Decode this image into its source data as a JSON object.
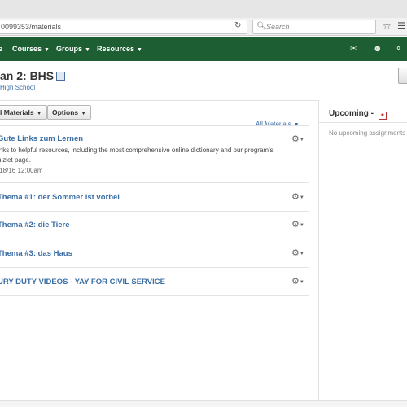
{
  "browser": {
    "url": "0099353/materials",
    "search_placeholder": "Search"
  },
  "nav": {
    "items": [
      {
        "label": "e"
      },
      {
        "label": "Courses"
      },
      {
        "label": "Groups"
      },
      {
        "label": "Resources"
      }
    ]
  },
  "header": {
    "title": "an 2: BHS",
    "school": "High School"
  },
  "toolbar": {
    "materials_label": "l Materials",
    "options_label": "Options",
    "filter_label": "All Materials"
  },
  "materials": [
    {
      "title": "Gute Links zum Lernen",
      "description": "inks to helpful resources, including the most comprehensive online dictionary and our program's uizlet page.",
      "date": "/18/16 12:00am"
    },
    {
      "title": "Thema #1: der Sommer ist vorbei"
    },
    {
      "title": "Thema #2: die Tiere"
    },
    {
      "title": "Thema #3: das Haus"
    },
    {
      "title": "URY DUTY VIDEOS - YAY FOR CIVIL SERVICE"
    }
  ],
  "upcoming": {
    "title": "Upcoming",
    "empty_text": "No upcoming assignments"
  }
}
